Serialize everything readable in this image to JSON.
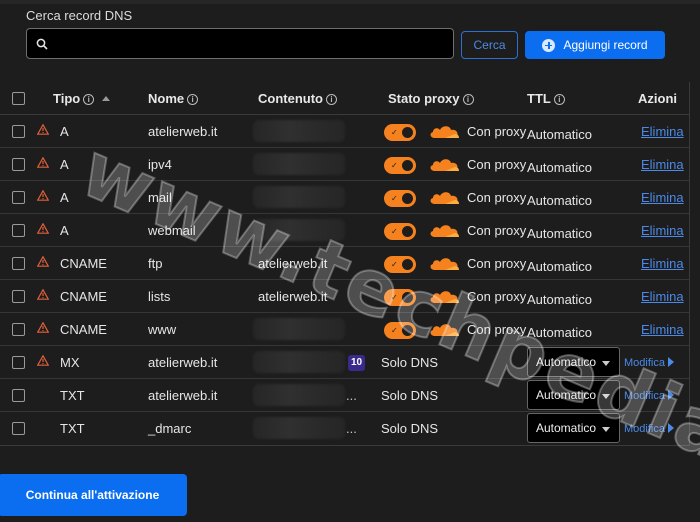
{
  "search": {
    "label": "Cerca record DNS",
    "value": "",
    "placeholder": "",
    "button_label": "Cerca"
  },
  "add_button_label": "Aggiungi record",
  "columns": {
    "type": "Tipo",
    "name": "Nome",
    "content": "Contenuto",
    "proxy": "Stato proxy",
    "ttl": "TTL",
    "actions": "Azioni"
  },
  "records": [
    {
      "warning": true,
      "type": "A",
      "name": "atelierweb.it",
      "content": "",
      "proxy": "Con proxy",
      "proxied": true,
      "ttl": "Automatico",
      "action": "Elimina"
    },
    {
      "warning": true,
      "type": "A",
      "name": "ipv4",
      "content": "",
      "proxy": "Con proxy",
      "proxied": true,
      "ttl": "Automatico",
      "action": "Elimina"
    },
    {
      "warning": true,
      "type": "A",
      "name": "mail",
      "content": "",
      "proxy": "Con proxy",
      "proxied": true,
      "ttl": "Automatico",
      "action": "Elimina"
    },
    {
      "warning": true,
      "type": "A",
      "name": "webmail",
      "content": "",
      "proxy": "Con proxy",
      "proxied": true,
      "ttl": "Automatico",
      "action": "Elimina"
    },
    {
      "warning": true,
      "type": "CNAME",
      "name": "ftp",
      "content": "atelierweb.it",
      "proxy": "Con proxy",
      "proxied": true,
      "ttl": "Automatico",
      "action": "Elimina"
    },
    {
      "warning": true,
      "type": "CNAME",
      "name": "lists",
      "content": "atelierweb.it",
      "proxy": "Con proxy",
      "proxied": true,
      "ttl": "Automatico",
      "action": "Elimina"
    },
    {
      "warning": true,
      "type": "CNAME",
      "name": "www",
      "content": "",
      "proxy": "Con proxy",
      "proxied": true,
      "ttl": "Automatico",
      "action": "Elimina"
    },
    {
      "warning": true,
      "type": "MX",
      "name": "atelierweb.it",
      "content": "",
      "priority": "10",
      "proxy": "Solo DNS",
      "proxied": false,
      "ttl": "Automatico",
      "action": "Modifica"
    },
    {
      "warning": false,
      "type": "TXT",
      "name": "atelierweb.it",
      "content": "...",
      "proxy": "Solo DNS",
      "proxied": false,
      "ttl": "Automatico",
      "action": "Modifica"
    },
    {
      "warning": false,
      "type": "TXT",
      "name": "_dmarc",
      "content": "...",
      "proxy": "Solo DNS",
      "proxied": false,
      "ttl": "Automatico",
      "action": "Modifica"
    }
  ],
  "continue_button_label": "Continua all'attivazione",
  "watermark": "www.techpedia.it",
  "colors": {
    "accent": "#0b6df0",
    "proxy_orange": "#f6821f",
    "link": "#4b8ae8",
    "background": "#1d1d1d"
  }
}
